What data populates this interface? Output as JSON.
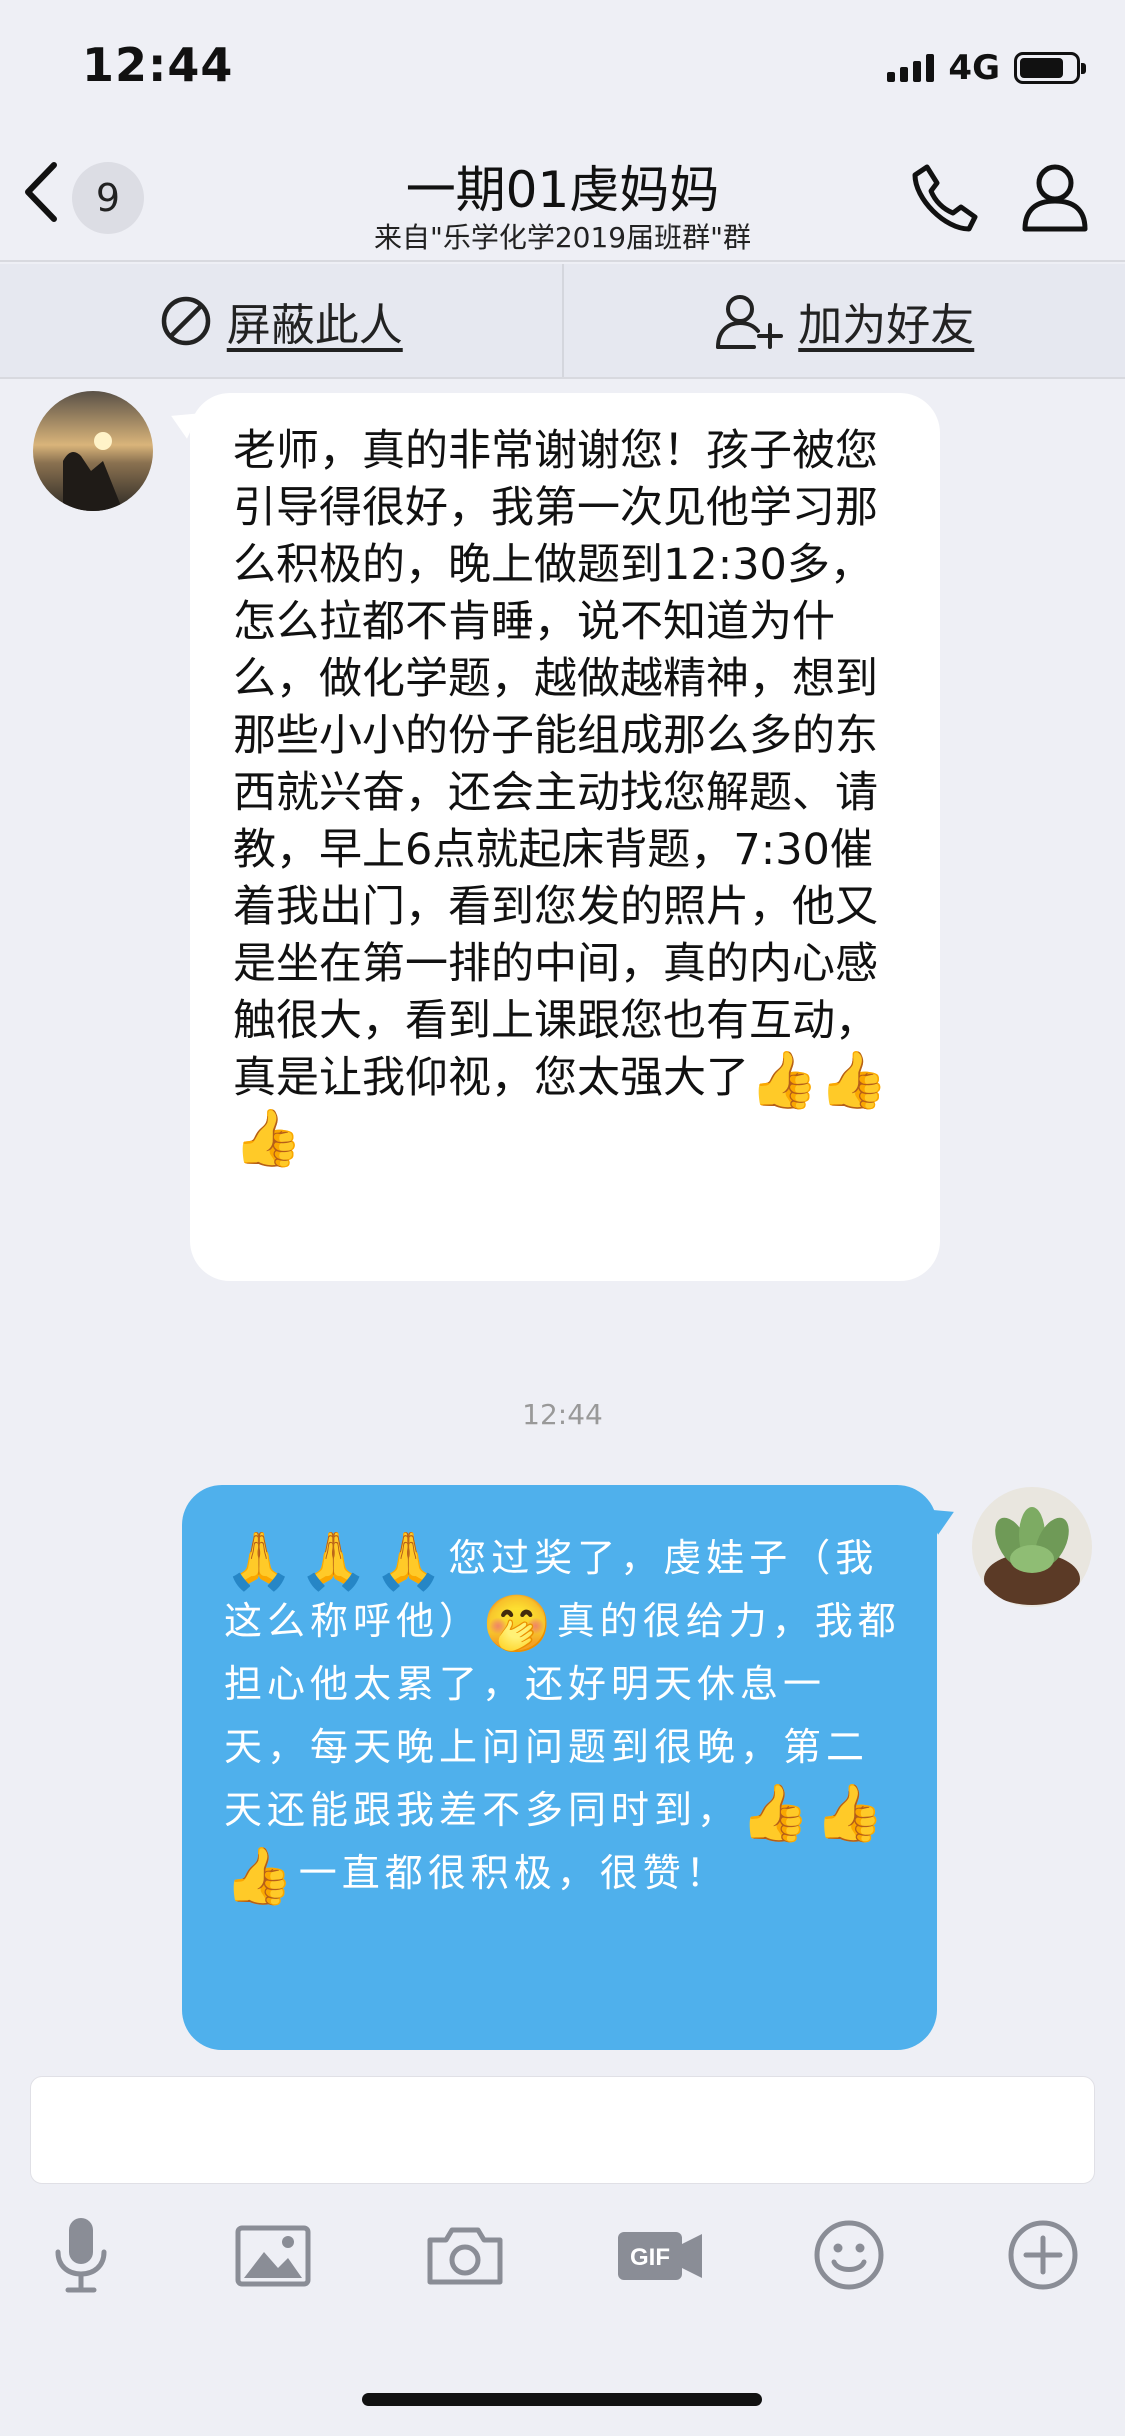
{
  "status_bar": {
    "time": "12:44",
    "network": "4G",
    "battery_level": 0.8
  },
  "header": {
    "unread_count": "9",
    "title": "一期01虔妈妈",
    "subtitle": "来自\"乐学化学2019届班群\"群"
  },
  "actions": {
    "block_label": "屏蔽此人",
    "add_friend_label": "加为好友"
  },
  "messages": [
    {
      "direction": "incoming",
      "text": "老师，真的非常谢谢您！孩子被您引导得很好，我第一次见他学习那么积极的，晚上做题到12:30多，怎么拉都不肯睡，说不知道为什么，做化学题，越做越精神，想到那些小小的份子能组成那么多的东西就兴奋，还会主动找您解题、请教，早上6点就起床背题，7:30催着我出门，看到您发的照片，他又是坐在第一排的中间，真的内心感触很大，看到上课跟您也有互动，真是让我仰视，您太强大了",
      "trailing_emojis": [
        "👍",
        "👍",
        "👍"
      ]
    },
    {
      "direction": "outgoing",
      "leading_emojis": [
        "🙏",
        "🙏",
        "🙏"
      ],
      "text_part1": "您过奖了，虔娃子（我这么称呼他）",
      "inline_emoji": "🤭",
      "text_part2": "真的很给力，我都担心他太累了，还好明天休息一天，每天晚上问问题到很晚，第二天还能跟我差不多同时到，",
      "middle_emojis": [
        "👍",
        "👍",
        "👍"
      ],
      "text_part3": "一直都很积极，很赞！"
    }
  ],
  "timestamp": "12:44",
  "toolbar": {
    "icons": [
      "microphone-icon",
      "image-icon",
      "camera-icon",
      "gif-icon",
      "emoji-icon",
      "plus-icon"
    ],
    "gif_label": "GIF"
  },
  "colors": {
    "outgoing_bubble": "#4fb0ec",
    "background": "#eeeff5"
  }
}
